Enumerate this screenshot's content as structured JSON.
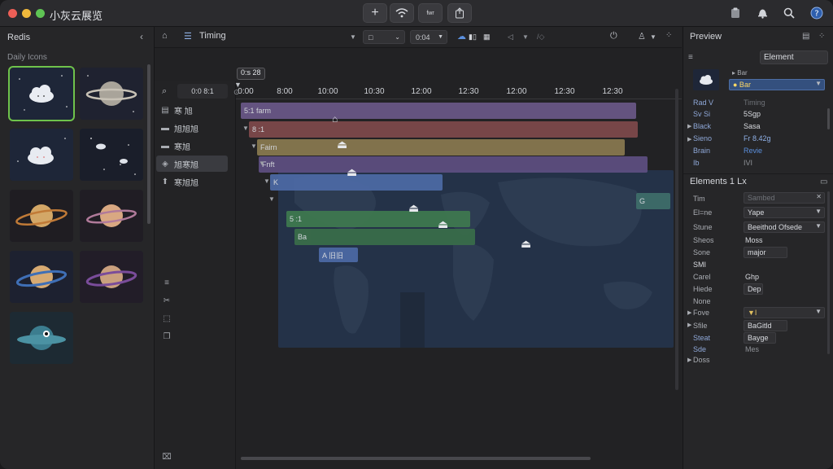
{
  "window": {
    "title": "小灰云展览",
    "colors": {
      "close": "#ed5f57",
      "minimize": "#f0b93c",
      "zoom": "#5fc454",
      "accent_selected": "#6fc34b",
      "focus_blue": "#3c66a6"
    }
  },
  "toolbar": {
    "center_buttons": [
      {
        "icon": "plus-icon",
        "glyph": "+"
      },
      {
        "icon": "wifi-icon",
        "glyph": "◠"
      },
      {
        "icon": "doc-icon",
        "label": "fwr"
      },
      {
        "icon": "share-icon",
        "glyph": "⇪"
      }
    ],
    "right_icons": [
      "clipboard-icon",
      "bell-icon",
      "search-icon",
      "help-icon"
    ]
  },
  "assets_panel": {
    "title": "Redis",
    "section": "Daily Icons",
    "items": [
      {
        "name": "cloud-dark",
        "selected": true
      },
      {
        "name": "saturn-gray",
        "selected": false
      },
      {
        "name": "cloud-white",
        "selected": false
      },
      {
        "name": "stars-cloud",
        "selected": false
      },
      {
        "name": "saturn-orange",
        "selected": false
      },
      {
        "name": "saturn-pink",
        "selected": false
      },
      {
        "name": "saturn-blue",
        "selected": false
      },
      {
        "name": "saturn-purple",
        "selected": false
      },
      {
        "name": "planet-teal-eye",
        "selected": false
      }
    ]
  },
  "subbar": {
    "label": "Timing",
    "field1": "□",
    "field2": "0:04",
    "icons": [
      "cloud-upload-icon",
      "chart-icon",
      "cursor-icon",
      "filter-icon",
      "power-icon",
      "pin-icon",
      "grid-icon"
    ]
  },
  "layers": {
    "header": "0:0 8:1",
    "items": [
      {
        "label": "寒 旭",
        "icon": "box-icon",
        "selected": false
      },
      {
        "label": "旭旭旭",
        "icon": "card-icon",
        "selected": false
      },
      {
        "label": "寒旭",
        "icon": "card-icon",
        "selected": false
      },
      {
        "label": "旭寒旭",
        "icon": "diamond-icon",
        "selected": true
      },
      {
        "label": "寒旭旭",
        "icon": "arrow-up-icon",
        "selected": false
      }
    ],
    "tools": [
      "sort-icon",
      "scissors-icon",
      "select-icon",
      "copy-icon"
    ],
    "bottom_icon": "trash-icon"
  },
  "timeline": {
    "playhead_label": "0:s 28",
    "ruler": [
      "0:00",
      "8:00",
      "10:00",
      "10:30",
      "12:00",
      "12:30",
      "12:00",
      "12:30",
      "12:30"
    ],
    "tracks": [
      {
        "label": "5:1 farm",
        "color": "#6a5888"
      },
      {
        "label": "8 :1",
        "color": "#8a4a4a"
      },
      {
        "label": "Fairn",
        "color": "#8a7a50"
      },
      {
        "label": "Fnft",
        "color": "#5e4f82"
      },
      {
        "label": "K",
        "color": "#4d6aa6"
      },
      {
        "label": "G",
        "color": "#4a6e8a"
      },
      {
        "label": "5 :1",
        "color": "#3f7a4f"
      },
      {
        "label": "Ba",
        "color": "#3f7a4f"
      },
      {
        "label": "A 旧旧",
        "color": "#4d6aa6"
      }
    ]
  },
  "inspector": {
    "title": "Preview",
    "element_tab": "Element",
    "preview_select": "● Bar",
    "rows1": [
      {
        "key": "Rad V",
        "val": "Timing"
      },
      {
        "key": "Sv Si",
        "val": "5Sgp"
      },
      {
        "key": "Black",
        "val": "Sasa"
      },
      {
        "key": "Sieno",
        "val": "Fr 8.42g"
      },
      {
        "key": "Brain",
        "val": "Revie"
      },
      {
        "key": "Ib",
        "val": "IVI"
      }
    ],
    "section2": "Elements 1 Lx",
    "rows2": [
      {
        "key": "Tim",
        "val": "Sambed"
      },
      {
        "key": "El=ne",
        "val": "Yape"
      },
      {
        "key": "Stune",
        "val": "Beeithod Ofsede"
      },
      {
        "key": "Sheos",
        "val": "Moss"
      },
      {
        "key": "Sone",
        "val": "major"
      },
      {
        "key": "SMI",
        "val": ""
      },
      {
        "key": "Carel",
        "val": "Ghp"
      },
      {
        "key": "Hiede",
        "val": "Dep"
      },
      {
        "key": "None",
        "val": ""
      },
      {
        "key": "Fove",
        "val": "▼I"
      },
      {
        "key": "Sfile",
        "val": "BaGitld"
      },
      {
        "key": "Steat",
        "val": "Bayge"
      },
      {
        "key": "Sde",
        "val": "Mes"
      },
      {
        "key": "Doss",
        "val": ""
      }
    ]
  }
}
